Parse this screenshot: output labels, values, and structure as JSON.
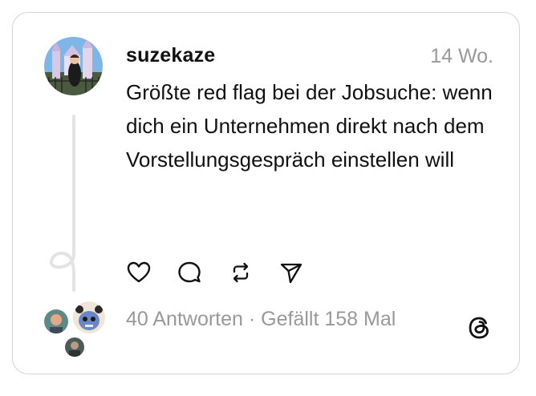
{
  "post": {
    "username": "suzekaze",
    "timestamp": "14 Wo.",
    "text": "Größte red flag bei der Jobsuche: wenn dich ein Unternehmen direkt nach dem Vorstellungsgespräch einstellen will"
  },
  "actions": {
    "icons": [
      "heart-icon",
      "comment-icon",
      "repost-icon",
      "share-icon"
    ]
  },
  "stats": {
    "replies": "40 Antworten",
    "separator": "·",
    "likes": "Gefällt 158 Mal"
  },
  "colors": {
    "text": "#111111",
    "muted": "#999999",
    "border": "#d4d4d4",
    "thread_line": "#e3e3e3"
  }
}
